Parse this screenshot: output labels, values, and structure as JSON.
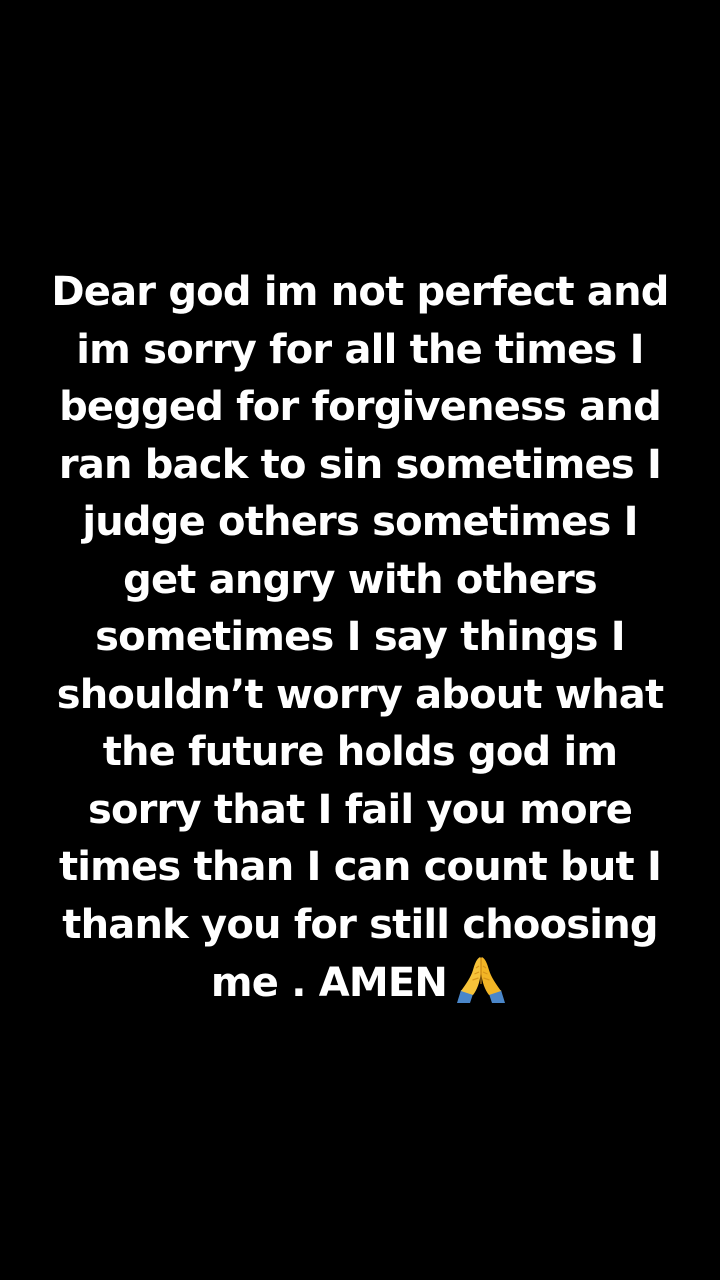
{
  "post": {
    "lines": [
      "Dear god im not perfect and",
      "im sorry for all the times I",
      "begged for forgiveness and",
      "ran back to sin sometimes I",
      "judge others sometimes I",
      "get angry with others",
      "sometimes I say things I",
      "shouldn’t worry about what",
      "the future holds god im",
      "sorry that I fail you more",
      "times than I can count but I",
      "thank you for still choosing",
      "me . AMEN"
    ],
    "emoji": "folded-hands-icon",
    "colors": {
      "background": "#000000",
      "text": "#ffffff"
    }
  }
}
